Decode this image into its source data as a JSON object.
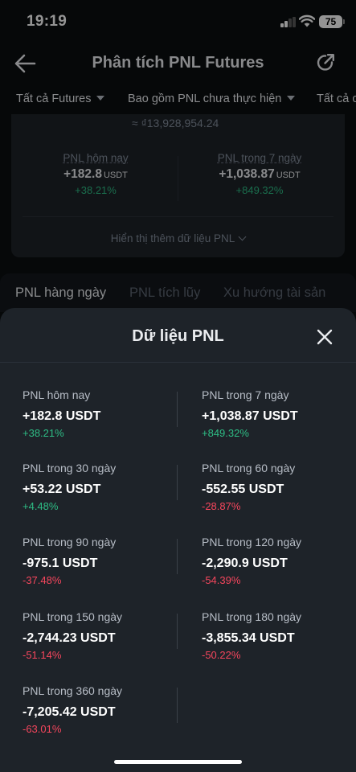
{
  "status_bar": {
    "time": "19:19",
    "battery": "75"
  },
  "nav": {
    "title": "Phân tích PNL Futures"
  },
  "filters": [
    {
      "label": "Tất cả Futures"
    },
    {
      "label": "Bao gồm PNL chưa thực hiện"
    },
    {
      "label": "Tất cả c"
    }
  ],
  "summary": {
    "approx_value": "≈ ₫13,928,954.24",
    "today": {
      "label": "PNL hôm nay",
      "value": "+182.8",
      "unit": "USDT",
      "pct": "+38.21%"
    },
    "week": {
      "label": "PNL trong 7 ngày",
      "value": "+1,038.87",
      "unit": "USDT",
      "pct": "+849.32%"
    },
    "more_label": "Hiển thị thêm dữ liệu PNL"
  },
  "tabs": [
    {
      "label": "PNL hàng ngày"
    },
    {
      "label": "PNL tích lũy"
    },
    {
      "label": "Xu hướng tài sản"
    }
  ],
  "sheet": {
    "title": "Dữ liệu PNL",
    "items": [
      {
        "label": "PNL hôm nay",
        "value": "+182.8 USDT",
        "pct": "+38.21%",
        "trend": "pos"
      },
      {
        "label": "PNL trong 7 ngày",
        "value": "+1,038.87 USDT",
        "pct": "+849.32%",
        "trend": "pos"
      },
      {
        "label": "PNL trong 30 ngày",
        "value": "+53.22 USDT",
        "pct": "+4.48%",
        "trend": "pos"
      },
      {
        "label": "PNL trong 60 ngày",
        "value": "-552.55 USDT",
        "pct": "-28.87%",
        "trend": "neg"
      },
      {
        "label": "PNL trong 90 ngày",
        "value": "-975.1 USDT",
        "pct": "-37.48%",
        "trend": "neg"
      },
      {
        "label": "PNL trong 120 ngày",
        "value": "-2,290.9 USDT",
        "pct": "-54.39%",
        "trend": "neg"
      },
      {
        "label": "PNL trong 150 ngày",
        "value": "-2,744.23 USDT",
        "pct": "-51.14%",
        "trend": "neg"
      },
      {
        "label": "PNL trong 180 ngày",
        "value": "-3,855.34 USDT",
        "pct": "-50.22%",
        "trend": "neg"
      },
      {
        "label": "PNL trong 360 ngày",
        "value": "-7,205.42 USDT",
        "pct": "-63.01%",
        "trend": "neg"
      }
    ]
  },
  "colors": {
    "positive": "#2ebd85",
    "negative": "#f6465d",
    "sheet_bg": "#1e2329"
  }
}
